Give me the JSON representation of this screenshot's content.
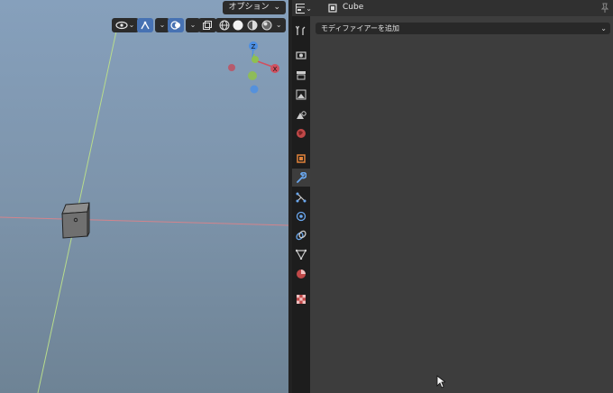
{
  "viewport": {
    "options_label": "オプション",
    "gizmo": {
      "z": "Z",
      "x": "X"
    }
  },
  "properties": {
    "object_name": "Cube",
    "add_modifier_label": "モディファイアーを追加"
  },
  "colors": {
    "accent": "#4772b3",
    "axis_x": "#d0505f",
    "axis_y": "#8fc050",
    "axis_z": "#4d8fe3"
  }
}
